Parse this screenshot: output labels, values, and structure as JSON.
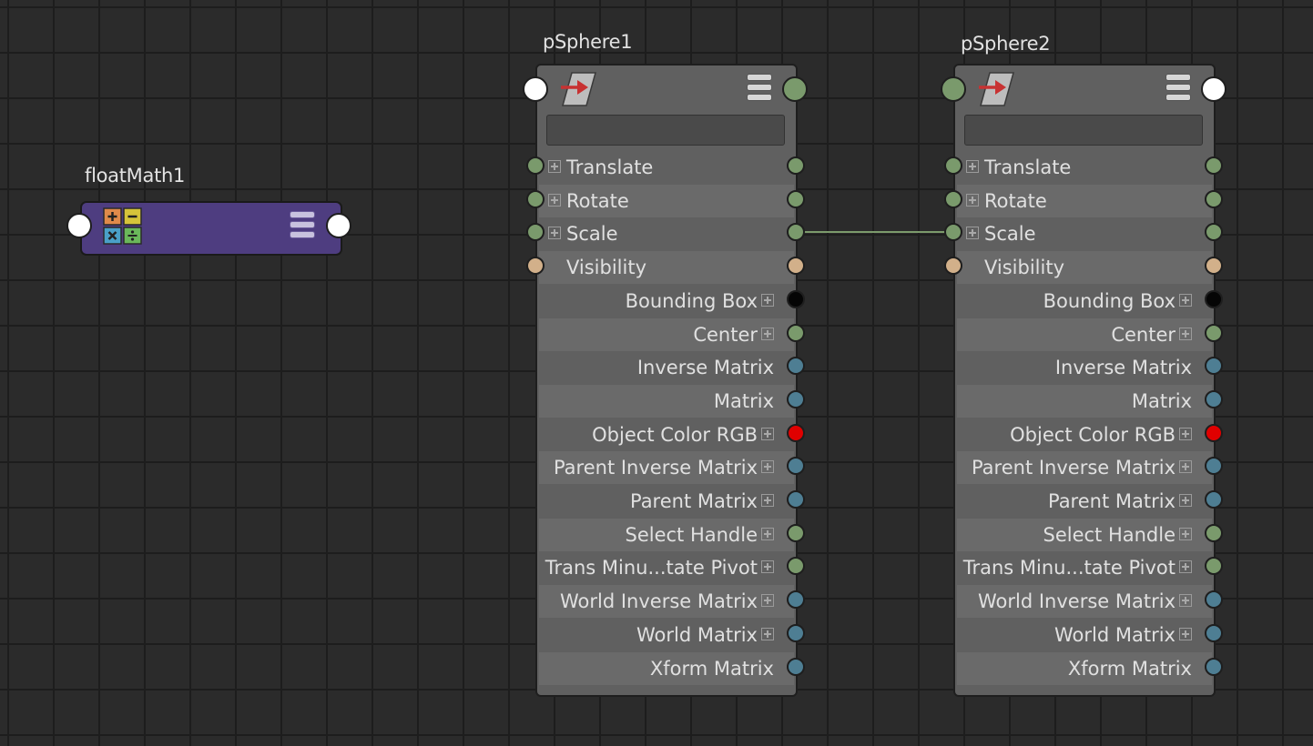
{
  "colors": {
    "canvas": "#2b2b2b",
    "grid": "#1d1d1d",
    "node_body": "#606060",
    "float_math_body": "#4e3d80",
    "port_green": "#7a9a6c",
    "port_tan": "#d2b08a",
    "port_blue": "#4e7e93",
    "port_red": "#e00000",
    "port_black": "#050505",
    "port_white": "#ffffff",
    "connection": "#7c9a6c"
  },
  "icons": {
    "float_math": "calculator-operators-icon",
    "transform": "transform-arrow-icon",
    "options": "hamburger-menu-icon"
  },
  "float_math_node": {
    "title": "floatMath1"
  },
  "nodes": [
    {
      "title": "pSphere1",
      "name_value": "",
      "attributes": [
        {
          "label": "Translate",
          "align": "left",
          "port": "green",
          "in_port": "green"
        },
        {
          "label": "Rotate",
          "align": "left",
          "port": "green",
          "in_port": "green"
        },
        {
          "label": "Scale",
          "align": "left",
          "port": "green",
          "in_port": "green"
        },
        {
          "label": "Visibility",
          "align": "left",
          "port": "tan",
          "in_port": "tan"
        },
        {
          "label": "Bounding Box",
          "align": "right",
          "port": "black"
        },
        {
          "label": "Center",
          "align": "right",
          "port": "green"
        },
        {
          "label": "Inverse Matrix",
          "align": "right",
          "port": "blue"
        },
        {
          "label": "Matrix",
          "align": "right",
          "port": "blue"
        },
        {
          "label": "Object Color RGB",
          "align": "right",
          "port": "red"
        },
        {
          "label": "Parent Inverse Matrix",
          "align": "right",
          "port": "blue"
        },
        {
          "label": "Parent Matrix",
          "align": "right",
          "port": "blue"
        },
        {
          "label": "Select Handle",
          "align": "right",
          "port": "green"
        },
        {
          "label": "Trans Minu...tate Pivot",
          "align": "right",
          "port": "green"
        },
        {
          "label": "World Inverse Matrix",
          "align": "right",
          "port": "blue"
        },
        {
          "label": "World Matrix",
          "align": "right",
          "port": "blue"
        },
        {
          "label": "Xform Matrix",
          "align": "right",
          "port": "blue"
        }
      ]
    },
    {
      "title": "pSphere2",
      "name_value": "",
      "attributes": [
        {
          "label": "Translate",
          "align": "left",
          "port": "green",
          "in_port": "green"
        },
        {
          "label": "Rotate",
          "align": "left",
          "port": "green",
          "in_port": "green"
        },
        {
          "label": "Scale",
          "align": "left",
          "port": "green",
          "in_port": "green"
        },
        {
          "label": "Visibility",
          "align": "left",
          "port": "tan",
          "in_port": "tan"
        },
        {
          "label": "Bounding Box",
          "align": "right",
          "port": "black"
        },
        {
          "label": "Center",
          "align": "right",
          "port": "green"
        },
        {
          "label": "Inverse Matrix",
          "align": "right",
          "port": "blue"
        },
        {
          "label": "Matrix",
          "align": "right",
          "port": "blue"
        },
        {
          "label": "Object Color RGB",
          "align": "right",
          "port": "red"
        },
        {
          "label": "Parent Inverse Matrix",
          "align": "right",
          "port": "blue"
        },
        {
          "label": "Parent Matrix",
          "align": "right",
          "port": "blue"
        },
        {
          "label": "Select Handle",
          "align": "right",
          "port": "green"
        },
        {
          "label": "Trans Minu...tate Pivot",
          "align": "right",
          "port": "green"
        },
        {
          "label": "World Inverse Matrix",
          "align": "right",
          "port": "blue"
        },
        {
          "label": "World Matrix",
          "align": "right",
          "port": "blue"
        },
        {
          "label": "Xform Matrix",
          "align": "right",
          "port": "blue"
        }
      ]
    }
  ],
  "connections": [
    {
      "from_node": "pSphere1",
      "from_attr": "Scale",
      "to_node": "pSphere2",
      "to_attr": "Scale"
    }
  ]
}
